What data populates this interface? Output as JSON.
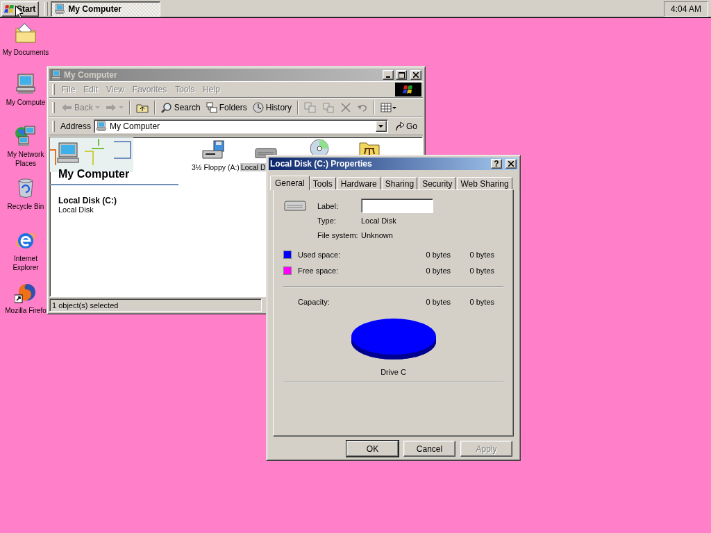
{
  "taskbar": {
    "start_label": "Start",
    "tasks": [
      {
        "label": "My Computer",
        "selected": true
      }
    ],
    "clock": "4:04 AM"
  },
  "desktop_icons": [
    {
      "label": "My Documents",
      "kind": "documents"
    },
    {
      "label": "My Compute",
      "kind": "computer"
    },
    {
      "label": "My Network Places",
      "kind": "network"
    },
    {
      "label": "Recycle Bin",
      "kind": "recycle"
    },
    {
      "label": "Internet Explorer",
      "kind": "ie"
    },
    {
      "label": "Mozilla Firefo",
      "kind": "firefox"
    }
  ],
  "explorer": {
    "title": "My Computer",
    "active": false,
    "menu": [
      "File",
      "Edit",
      "View",
      "Favorites",
      "Tools",
      "Help"
    ],
    "toolbar": [
      {
        "kind": "back",
        "label": "Back",
        "disabled": true
      },
      {
        "kind": "forward",
        "disabled": true
      },
      {
        "kind": "up",
        "disabled": false
      },
      {
        "kind": "search",
        "label": "Search",
        "disabled": false
      },
      {
        "kind": "folders",
        "label": "Folders",
        "disabled": false
      },
      {
        "kind": "history",
        "label": "History",
        "disabled": false
      },
      {
        "kind": "move",
        "disabled": true
      },
      {
        "kind": "copy",
        "disabled": true
      },
      {
        "kind": "delete",
        "disabled": true
      },
      {
        "kind": "undo",
        "disabled": true
      },
      {
        "kind": "views",
        "disabled": false
      }
    ],
    "address": {
      "label": "Address",
      "value": "My Computer",
      "go": "Go"
    },
    "pane": {
      "title": "My Computer",
      "selected_name": "Local Disk (C:)",
      "selected_type": "Local Disk"
    },
    "drives": [
      {
        "kind": "floppy",
        "label": "3½ Floppy (A:)",
        "selected": false
      },
      {
        "kind": "disk",
        "label": "Local D",
        "selected": true
      },
      {
        "kind": "cd",
        "selected": false
      },
      {
        "kind": "control",
        "selected": false
      }
    ],
    "status": "1 object(s) selected"
  },
  "dialog": {
    "title": "Local Disk (C:) Properties",
    "active": true,
    "help": "?",
    "tabs": [
      {
        "label": "General",
        "selected": true
      },
      {
        "label": "Tools",
        "selected": false
      },
      {
        "label": "Hardware",
        "selected": false
      },
      {
        "label": "Sharing",
        "selected": false
      },
      {
        "label": "Security",
        "selected": false
      },
      {
        "label": "Web Sharing",
        "selected": false
      }
    ],
    "label_field": {
      "label": "Label:"
    },
    "info": [
      {
        "label": "Type:",
        "value": "Local Disk"
      },
      {
        "label": "File system:",
        "value": "Unknown"
      }
    ],
    "spaces": [
      {
        "label": "Used space:",
        "color": "#0000ff",
        "bytes": "0 bytes",
        "size": "0 bytes"
      },
      {
        "label": "Free space:",
        "color": "#ff00ff",
        "bytes": "0 bytes",
        "size": "0 bytes"
      }
    ],
    "capacity": {
      "label": "Capacity:",
      "bytes": "0 bytes",
      "size": "0 bytes"
    },
    "drive_caption": "Drive C",
    "buttons": [
      {
        "label": "OK",
        "default": true,
        "disabled": false
      },
      {
        "label": "Cancel",
        "default": false,
        "disabled": false
      },
      {
        "label": "Apply",
        "default": false,
        "disabled": true
      }
    ]
  }
}
